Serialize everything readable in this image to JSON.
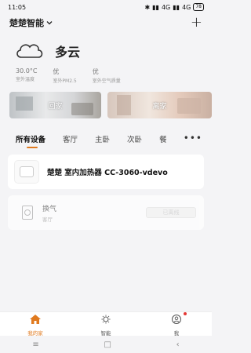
{
  "status_bar": {
    "time": "11:05",
    "network1": "4G",
    "network2": "4G",
    "battery": "78"
  },
  "header": {
    "home_name": "楚楚智能"
  },
  "weather": {
    "condition": "多云",
    "metrics": [
      {
        "value": "30.0°C",
        "label": "室外温度"
      },
      {
        "value": "优",
        "label": "室外PM2.5"
      },
      {
        "value": "优",
        "label": "室外空气质量"
      }
    ]
  },
  "scenes": [
    {
      "label": "回家"
    },
    {
      "label": "离家"
    }
  ],
  "tabs": [
    {
      "label": "所有设备",
      "active": true
    },
    {
      "label": "客厅"
    },
    {
      "label": "主卧"
    },
    {
      "label": "次卧"
    },
    {
      "label": "餐"
    }
  ],
  "devices": [
    {
      "name": "楚楚  室内加热器  CC-3060-vdevo"
    },
    {
      "name": "换气",
      "room": "客厅",
      "status": "已离线"
    }
  ],
  "bottom_nav": [
    {
      "label": "我的家",
      "active": true
    },
    {
      "label": "智能"
    },
    {
      "label": "我"
    }
  ],
  "colors": {
    "accent": "#e07a1f"
  }
}
